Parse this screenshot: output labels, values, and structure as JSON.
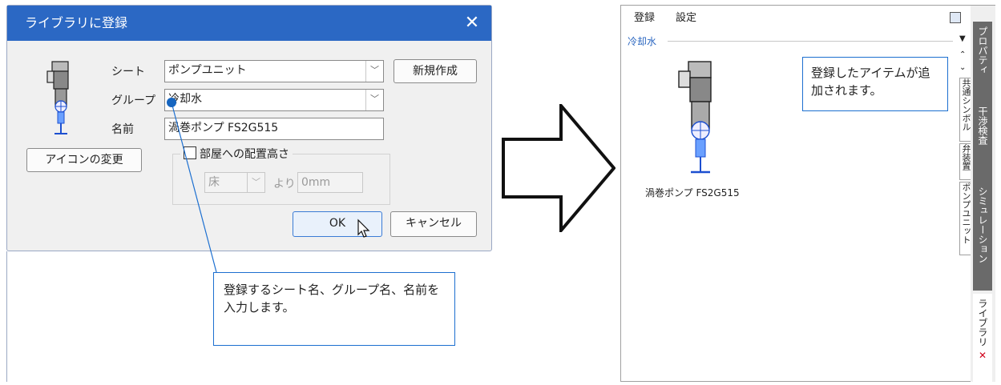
{
  "dialog": {
    "title": "ライブラリに登録",
    "close_glyph": "✕",
    "sheet_label": "シート",
    "sheet_value": "ポンプユニット",
    "group_label": "グループ",
    "group_value": "冷却水",
    "name_label": "名前",
    "name_value": "渦巻ポンプ FS2G515",
    "new_button": "新規作成",
    "icon_change_button": "アイコンの変更",
    "room_height_checkbox": "部屋への配置高さ",
    "floor_value": "床",
    "from_label": "より",
    "offset_value": "0mm",
    "ok_button": "OK",
    "cancel_button": "キャンセル"
  },
  "callouts": {
    "left": "登録するシート名、グループ名、名前を入力します。",
    "right": "登録したアイテムが追加されます。"
  },
  "panel": {
    "menu": [
      "登録",
      "設定"
    ],
    "group_header": "冷却水",
    "item_name": "渦巻ポンプ FS2G515",
    "side_tabs": [
      "プロパティ",
      "干渉検査",
      "シミュレーション",
      "ライブラリ"
    ],
    "sheet_tabs": [
      "共通シンボル",
      "弁装置",
      "ポンプユニット"
    ],
    "close_glyph": "✕"
  },
  "colors": {
    "title_bar": "#2b68c4",
    "callout_border": "#1c6fd0",
    "callout_dot": "#1565c0",
    "arrow": "#111111",
    "close_x": "#d0021b"
  }
}
